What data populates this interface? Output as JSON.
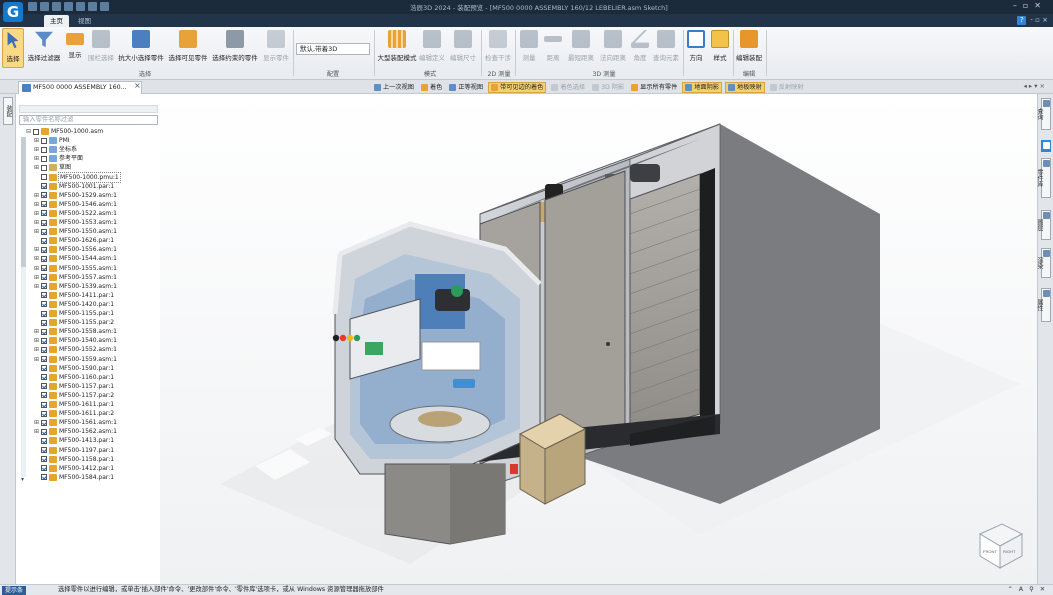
{
  "app": {
    "title": "浩辰3D 2024 - 装配预览 - [MF500 0000 ASSEMBLY 160/12 LEBELIER.asm Sketch]",
    "logo_letter": "G"
  },
  "ribbon_tabs": [
    {
      "label": "主页",
      "active": true
    },
    {
      "label": "视图",
      "active": false
    }
  ],
  "ribbon": {
    "buttons": [
      {
        "label": "选择",
        "icon": "select-arrow-icon",
        "selected": true,
        "disabled": false
      },
      {
        "label": "选择过滤器",
        "icon": "filter-icon",
        "selected": false,
        "disabled": false
      },
      {
        "label": "显示",
        "icon": "show-icon",
        "selected": false,
        "disabled": false
      },
      {
        "label": "围栏选择",
        "icon": "fence-select-icon",
        "selected": false,
        "disabled": true
      },
      {
        "label": "抗大小选择零件",
        "icon": "select-by-size-icon",
        "selected": false,
        "disabled": false
      },
      {
        "label": "选择可见零件",
        "icon": "select-visible-icon",
        "selected": false,
        "disabled": false
      },
      {
        "label": "选择约束的零件",
        "icon": "select-constrained-icon",
        "selected": false,
        "disabled": false
      },
      {
        "label": "显示零件",
        "icon": "show-part-icon",
        "selected": false,
        "disabled": true
      },
      {
        "label": "大型装配模式",
        "icon": "large-assembly-icon",
        "selected": false,
        "disabled": false
      },
      {
        "label": "编辑定义",
        "icon": "edit-definition-icon",
        "selected": false,
        "disabled": true
      },
      {
        "label": "编辑尺寸",
        "icon": "edit-dimension-icon",
        "selected": false,
        "disabled": true
      },
      {
        "label": "检查干涉",
        "icon": "interference-icon",
        "selected": false,
        "disabled": true
      },
      {
        "label": "测量",
        "icon": "measure-icon",
        "selected": false,
        "disabled": true
      },
      {
        "label": "距离",
        "icon": "distance-icon",
        "selected": false,
        "disabled": true
      },
      {
        "label": "最短距离",
        "icon": "min-distance-icon",
        "selected": false,
        "disabled": true
      },
      {
        "label": "法向距离",
        "icon": "normal-distance-icon",
        "selected": false,
        "disabled": true
      },
      {
        "label": "角度",
        "icon": "angle-icon",
        "selected": false,
        "disabled": true
      },
      {
        "label": "查询元素",
        "icon": "query-icon",
        "selected": false,
        "disabled": true
      },
      {
        "label": "方向",
        "icon": "orientation-icon",
        "selected": false,
        "disabled": false
      },
      {
        "label": "样式",
        "icon": "style-icon",
        "selected": false,
        "disabled": false
      },
      {
        "label": "编辑装配",
        "icon": "edit-assembly-icon",
        "selected": false,
        "disabled": false
      }
    ],
    "groups": [
      {
        "label": "选择"
      },
      {
        "label": "配置"
      },
      {
        "label": "模式"
      },
      {
        "label": "2D 测量"
      },
      {
        "label": "3D 测量"
      },
      {
        "label": "编辑"
      }
    ],
    "style_dropdown": "默认,带着3D"
  },
  "document_tab": {
    "label": "MF500 0000 ASSEMBLY 160..."
  },
  "view_toolbar": [
    {
      "label": "上一次视图",
      "disabled": false,
      "highlight": false
    },
    {
      "label": "着色",
      "disabled": false,
      "highlight": false
    },
    {
      "label": "正等视图",
      "disabled": false,
      "highlight": false
    },
    {
      "label": "带可见边的着色",
      "disabled": false,
      "highlight": true
    },
    {
      "label": "着色选择",
      "disabled": true,
      "highlight": false
    },
    {
      "label": "3D 阴影",
      "disabled": true,
      "highlight": false
    },
    {
      "label": "显示所有零件",
      "disabled": false,
      "highlight": false
    },
    {
      "label": "地面阴影",
      "disabled": false,
      "highlight": true
    },
    {
      "label": "地板映射",
      "disabled": false,
      "highlight": true
    },
    {
      "label": "反射映射",
      "disabled": true,
      "highlight": false
    }
  ],
  "left_strip": {
    "label": "装配"
  },
  "tree": {
    "filter_placeholder": "输入零件名称过滤",
    "nodes": [
      {
        "label": "MF500-1000.asm",
        "level": 0,
        "expander": "⊟",
        "checked": false,
        "icon": "assembly-icon",
        "selected": false,
        "boxed": false
      },
      {
        "label": "PMI",
        "level": 1,
        "expander": "⊞",
        "checked": false,
        "icon": "pmi-icon",
        "selected": false,
        "boxed": false
      },
      {
        "label": "坐标系",
        "level": 1,
        "expander": "⊞",
        "checked": false,
        "icon": "coordinate-icon",
        "selected": false,
        "boxed": false
      },
      {
        "label": "参考平面",
        "level": 1,
        "expander": "⊞",
        "checked": false,
        "icon": "plane-icon",
        "selected": false,
        "boxed": false
      },
      {
        "label": "草图",
        "level": 1,
        "expander": "⊞",
        "checked": false,
        "icon": "sketch-icon",
        "selected": false,
        "boxed": false
      },
      {
        "label": "MF500-1000.pmu:1",
        "level": 1,
        "expander": "",
        "checked": false,
        "icon": "part-icon",
        "selected": false,
        "boxed": true
      },
      {
        "label": "MF500-1001.par:1",
        "level": 1,
        "expander": "",
        "checked": true,
        "icon": "part-icon",
        "selected": false,
        "boxed": false
      },
      {
        "label": "MF500-1529.asm:1",
        "level": 1,
        "expander": "⊞",
        "checked": true,
        "icon": "subassembly-icon",
        "selected": false,
        "boxed": false
      },
      {
        "label": "MF500-1546.asm:1",
        "level": 1,
        "expander": "⊞",
        "checked": true,
        "icon": "subassembly-icon",
        "selected": false,
        "boxed": false
      },
      {
        "label": "MF500-1522.asm:1",
        "level": 1,
        "expander": "⊞",
        "checked": true,
        "icon": "subassembly-icon",
        "selected": false,
        "boxed": false
      },
      {
        "label": "MF500-1553.asm:1",
        "level": 1,
        "expander": "⊞",
        "checked": true,
        "icon": "subassembly-icon",
        "selected": false,
        "boxed": false
      },
      {
        "label": "MF500-1550.asm:1",
        "level": 1,
        "expander": "⊞",
        "checked": true,
        "icon": "subassembly-icon",
        "selected": false,
        "boxed": false
      },
      {
        "label": "MF500-1626.par:1",
        "level": 1,
        "expander": "",
        "checked": true,
        "icon": "part-icon",
        "selected": false,
        "boxed": false
      },
      {
        "label": "MF500-1556.asm:1",
        "level": 1,
        "expander": "⊞",
        "checked": true,
        "icon": "subassembly-icon",
        "selected": false,
        "boxed": false
      },
      {
        "label": "MF500-1544.asm:1",
        "level": 1,
        "expander": "⊞",
        "checked": true,
        "icon": "subassembly-icon",
        "selected": false,
        "boxed": false
      },
      {
        "label": "MF500-1555.asm:1",
        "level": 1,
        "expander": "⊞",
        "checked": true,
        "icon": "subassembly-icon",
        "selected": false,
        "boxed": false
      },
      {
        "label": "MF500-1557.asm:1",
        "level": 1,
        "expander": "⊞",
        "checked": true,
        "icon": "subassembly-icon",
        "selected": false,
        "boxed": false
      },
      {
        "label": "MF500-1539.asm:1",
        "level": 1,
        "expander": "⊞",
        "checked": true,
        "icon": "subassembly-icon",
        "selected": false,
        "boxed": false
      },
      {
        "label": "MF500-1411.par:1",
        "level": 1,
        "expander": "",
        "checked": true,
        "icon": "part-icon",
        "selected": false,
        "boxed": false
      },
      {
        "label": "MF500-1420.par:1",
        "level": 1,
        "expander": "",
        "checked": true,
        "icon": "part-icon",
        "selected": false,
        "boxed": false
      },
      {
        "label": "MF500-1155.par:1",
        "level": 1,
        "expander": "",
        "checked": true,
        "icon": "part-icon",
        "selected": false,
        "boxed": false
      },
      {
        "label": "MF500-1155.par:2",
        "level": 1,
        "expander": "",
        "checked": true,
        "icon": "part-icon",
        "selected": false,
        "boxed": false
      },
      {
        "label": "MF500-1558.asm:1",
        "level": 1,
        "expander": "⊞",
        "checked": true,
        "icon": "subassembly-icon",
        "selected": false,
        "boxed": false
      },
      {
        "label": "MF500-1540.asm:1",
        "level": 1,
        "expander": "⊞",
        "checked": true,
        "icon": "subassembly-icon",
        "selected": false,
        "boxed": false
      },
      {
        "label": "MF500-1552.asm:1",
        "level": 1,
        "expander": "⊞",
        "checked": true,
        "icon": "subassembly-icon",
        "selected": false,
        "boxed": false
      },
      {
        "label": "MF500-1559.asm:1",
        "level": 1,
        "expander": "⊞",
        "checked": true,
        "icon": "subassembly-icon",
        "selected": false,
        "boxed": false
      },
      {
        "label": "MF500-1590.par:1",
        "level": 1,
        "expander": "",
        "checked": true,
        "icon": "part-icon",
        "selected": false,
        "boxed": false
      },
      {
        "label": "MF500-1160.par:1",
        "level": 1,
        "expander": "",
        "checked": true,
        "icon": "part-icon",
        "selected": false,
        "boxed": false
      },
      {
        "label": "MF500-1157.par:1",
        "level": 1,
        "expander": "",
        "checked": true,
        "icon": "part-icon",
        "selected": false,
        "boxed": false
      },
      {
        "label": "MF500-1157.par:2",
        "level": 1,
        "expander": "",
        "checked": true,
        "icon": "part-icon",
        "selected": false,
        "boxed": false
      },
      {
        "label": "MF500-1611.par:1",
        "level": 1,
        "expander": "",
        "checked": true,
        "icon": "part-icon",
        "selected": false,
        "boxed": false
      },
      {
        "label": "MF500-1611.par:2",
        "level": 1,
        "expander": "",
        "checked": true,
        "icon": "part-icon",
        "selected": false,
        "boxed": false
      },
      {
        "label": "MF500-1561.asm:1",
        "level": 1,
        "expander": "⊞",
        "checked": true,
        "icon": "subassembly-icon",
        "selected": false,
        "boxed": false
      },
      {
        "label": "MF500-1562.asm:1",
        "level": 1,
        "expander": "⊞",
        "checked": true,
        "icon": "subassembly-icon",
        "selected": false,
        "boxed": false
      },
      {
        "label": "MF500-1413.par:1",
        "level": 1,
        "expander": "",
        "checked": true,
        "icon": "part-icon",
        "selected": false,
        "boxed": false
      },
      {
        "label": "MF500-1197.par:1",
        "level": 1,
        "expander": "",
        "checked": true,
        "icon": "part-icon",
        "selected": false,
        "boxed": false
      },
      {
        "label": "MF500-1158.par:1",
        "level": 1,
        "expander": "",
        "checked": true,
        "icon": "part-icon",
        "selected": false,
        "boxed": false
      },
      {
        "label": "MF500-1412.par:1",
        "level": 1,
        "expander": "",
        "checked": true,
        "icon": "part-icon",
        "selected": false,
        "boxed": false
      },
      {
        "label": "MF500-1584.par:1",
        "level": 1,
        "expander": "",
        "checked": true,
        "icon": "part-icon",
        "selected": false,
        "boxed": false
      }
    ]
  },
  "right_strip": [
    {
      "label": "查询",
      "icon": "query-icon"
    },
    {
      "label": "",
      "icon": "help-icon"
    },
    {
      "label": "零件库",
      "icon": "library-icon"
    },
    {
      "label": "图层",
      "icon": "layers-icon"
    },
    {
      "label": "渲染",
      "icon": "render-icon"
    },
    {
      "label": "属性",
      "icon": "properties-icon"
    }
  ],
  "view_cube": {
    "front": "FRONT",
    "right": "RIGHT"
  },
  "status": {
    "hint_button": "提示条",
    "text": "选择零件以进行编辑，或单击'插入部件'命令、'更改部件'命令、'零件库'选项卡，或从 Windows 资源管理器拖放部件"
  }
}
